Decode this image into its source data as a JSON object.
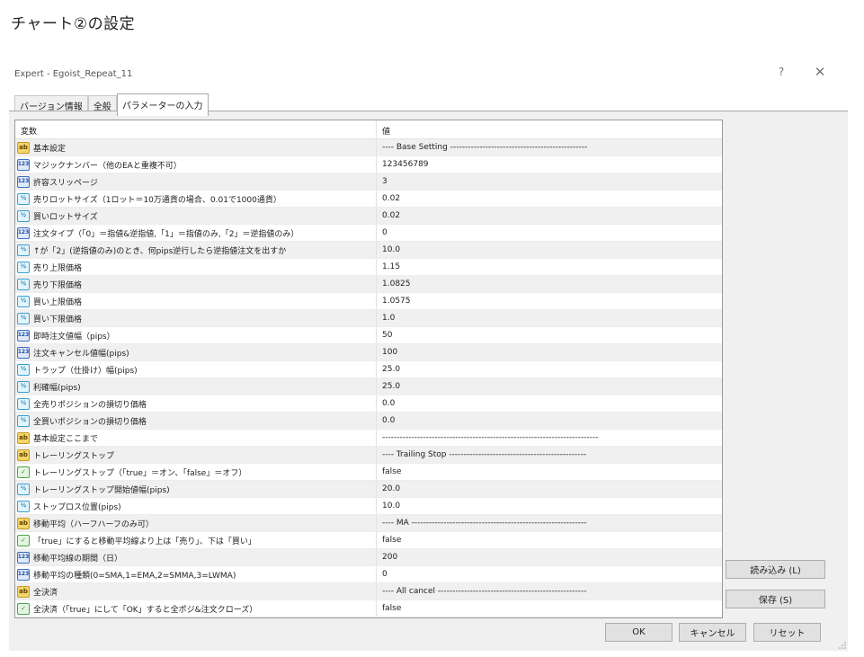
{
  "page_title": "チャート②の設定",
  "window": {
    "title": "Expert - Egoist_Repeat_11",
    "help_label": "?",
    "close_label": "✕"
  },
  "tabs": [
    {
      "label": "バージョン情報",
      "active": false
    },
    {
      "label": "全般",
      "active": false
    },
    {
      "label": "パラメーターの入力",
      "active": true
    }
  ],
  "table": {
    "headers": {
      "name": "変数",
      "value": "値"
    },
    "rows": [
      {
        "icon": "ab",
        "name": "基本設定",
        "value": "---- Base Setting -----------------------------------------------"
      },
      {
        "icon": "int",
        "name": "マジックナンバー（他のEAと重複不可）",
        "value": "123456789"
      },
      {
        "icon": "int",
        "name": "許容スリッページ",
        "value": "3"
      },
      {
        "icon": "dbl",
        "name": "売りロットサイズ（1ロット＝10万通貨の場合、0.01で1000通貨）",
        "value": "0.02"
      },
      {
        "icon": "dbl",
        "name": "買いロットサイズ",
        "value": "0.02"
      },
      {
        "icon": "int",
        "name": "注文タイプ（「0」＝指値&逆指値,「1」＝指値のみ,「2」＝逆指値のみ）",
        "value": "0"
      },
      {
        "icon": "dbl",
        "name": "↑が「2」(逆指値のみ)のとき、何pips逆行したら逆指値注文を出すか",
        "value": "10.0"
      },
      {
        "icon": "dbl",
        "name": "売り上限価格",
        "value": "1.15"
      },
      {
        "icon": "dbl",
        "name": "売り下限価格",
        "value": "1.0825"
      },
      {
        "icon": "dbl",
        "name": "買い上限価格",
        "value": "1.0575"
      },
      {
        "icon": "dbl",
        "name": "買い下限価格",
        "value": "1.0"
      },
      {
        "icon": "int",
        "name": "即時注文値幅（pips）",
        "value": "50"
      },
      {
        "icon": "int",
        "name": "注文キャンセル値幅(pips)",
        "value": "100"
      },
      {
        "icon": "dbl",
        "name": "トラップ（仕掛け）幅(pips)",
        "value": "25.0"
      },
      {
        "icon": "dbl",
        "name": "利確幅(pips)",
        "value": "25.0"
      },
      {
        "icon": "dbl",
        "name": "全売りポジションの損切り価格",
        "value": "0.0"
      },
      {
        "icon": "dbl",
        "name": "全買いポジションの損切り価格",
        "value": "0.0"
      },
      {
        "icon": "ab",
        "name": "基本設定ここまで",
        "value": "--------------------------------------------------------------------------"
      },
      {
        "icon": "ab",
        "name": "トレーリングストップ",
        "value": "---- Trailing Stop -----------------------------------------------"
      },
      {
        "icon": "bool",
        "name": "トレーリングストップ（「true」＝オン、「false」＝オフ）",
        "value": "false"
      },
      {
        "icon": "dbl",
        "name": "トレーリングストップ開始値幅(pips)",
        "value": "20.0"
      },
      {
        "icon": "dbl",
        "name": "ストップロス位置(pips)",
        "value": "10.0"
      },
      {
        "icon": "ab",
        "name": "移動平均（ハーフハーフのみ可）",
        "value": "---- MA ------------------------------------------------------------"
      },
      {
        "icon": "bool",
        "name": "「true」にすると移動平均線より上は「売り」、下は「買い」",
        "value": "false"
      },
      {
        "icon": "int",
        "name": "移動平均線の期間（日）",
        "value": "200"
      },
      {
        "icon": "int",
        "name": "移動平均の種類(0=SMA,1=EMA,2=SMMA,3=LWMA)",
        "value": "0"
      },
      {
        "icon": "ab",
        "name": "全決済",
        "value": "---- All cancel ---------------------------------------------------"
      },
      {
        "icon": "bool",
        "name": "全決済（「true」にして「OK」すると全ポジ&注文クローズ）",
        "value": "false"
      }
    ]
  },
  "side_buttons": {
    "load": "読み込み (L)",
    "save": "保存 (S)"
  },
  "bottom_buttons": {
    "ok": "OK",
    "cancel": "キャンセル",
    "reset": "リセット"
  },
  "icons": {
    "ab": "string-type-icon",
    "int": "integer-type-icon",
    "dbl": "double-type-icon",
    "bool": "boolean-type-icon"
  }
}
